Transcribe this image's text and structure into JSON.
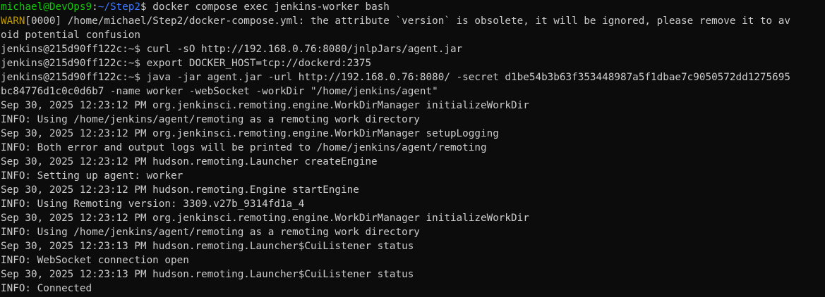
{
  "prompt": {
    "user_host": "michael@DevOps9",
    "sep": ":",
    "path": "~/Step2",
    "symbol": "$",
    "command": " docker compose exec jenkins-worker bash"
  },
  "warn": {
    "tag": "WARN",
    "rest": "[0000] /home/michael/Step2/docker-compose.yml: the attribute `version` is obsolete, it will be ignored, please remove it to av",
    "cont": "oid potential confusion"
  },
  "lines": [
    "jenkins@215d90ff122c:~$ curl -sO http://192.168.0.76:8080/jnlpJars/agent.jar",
    "jenkins@215d90ff122c:~$ export DOCKER_HOST=tcp://dockerd:2375",
    "jenkins@215d90ff122c:~$ java -jar agent.jar -url http://192.168.0.76:8080/ -secret d1be54b3b63f353448987a5f1dbae7c9050572dd1275695",
    "bc84776d1c0c0d6b7 -name worker -webSocket -workDir \"/home/jenkins/agent\"",
    "Sep 30, 2025 12:23:12 PM org.jenkinsci.remoting.engine.WorkDirManager initializeWorkDir",
    "INFO: Using /home/jenkins/agent/remoting as a remoting work directory",
    "Sep 30, 2025 12:23:12 PM org.jenkinsci.remoting.engine.WorkDirManager setupLogging",
    "INFO: Both error and output logs will be printed to /home/jenkins/agent/remoting",
    "Sep 30, 2025 12:23:12 PM hudson.remoting.Launcher createEngine",
    "INFO: Setting up agent: worker",
    "Sep 30, 2025 12:23:12 PM hudson.remoting.Engine startEngine",
    "INFO: Using Remoting version: 3309.v27b_9314fd1a_4",
    "Sep 30, 2025 12:23:12 PM org.jenkinsci.remoting.engine.WorkDirManager initializeWorkDir",
    "INFO: Using /home/jenkins/agent/remoting as a remoting work directory",
    "Sep 30, 2025 12:23:13 PM hudson.remoting.Launcher$CuiListener status",
    "INFO: WebSocket connection open",
    "Sep 30, 2025 12:23:13 PM hudson.remoting.Launcher$CuiListener status",
    "INFO: Connected"
  ],
  "colors": {
    "background": "#0c0c0c",
    "foreground": "#cccccc",
    "prompt_user": "#16c60c",
    "prompt_path": "#3b78ff",
    "warn": "#c19c00"
  }
}
